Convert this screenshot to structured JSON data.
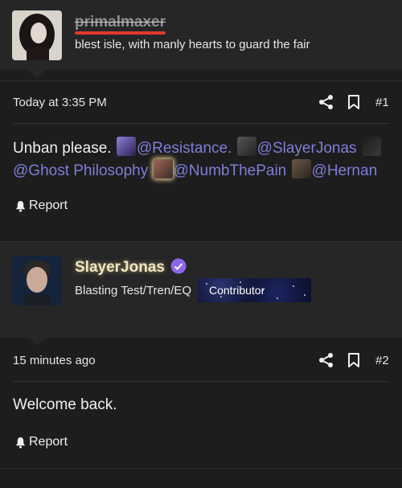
{
  "post1": {
    "username": "primalmaxer",
    "user_title": "blest isle, with manly hearts to guard the fair",
    "timestamp": "Today at 3:35 PM",
    "number": "#1",
    "content": {
      "text_intro": "Unban please.",
      "mentions": [
        "@Resistance.",
        "@SlayerJonas",
        "@Ghost Philosophy",
        "@NumbThePain",
        "@Hernan"
      ]
    },
    "report_label": "Report"
  },
  "post2": {
    "username": "SlayerJonas",
    "user_title": "Blasting Test/Tren/EQ",
    "badge": "Contributor",
    "timestamp": "15 minutes ago",
    "number": "#2",
    "content_text": "Welcome back.",
    "report_label": "Report"
  },
  "icons": [
    "share-icon",
    "bookmark-icon",
    "bell-icon",
    "verified-icon"
  ],
  "colors": {
    "background": "#1d1d1e",
    "mention": "#7e7fd6",
    "username_strike": "#e0392b",
    "verified": "#8b66e8",
    "username2": "#efe6c4"
  }
}
